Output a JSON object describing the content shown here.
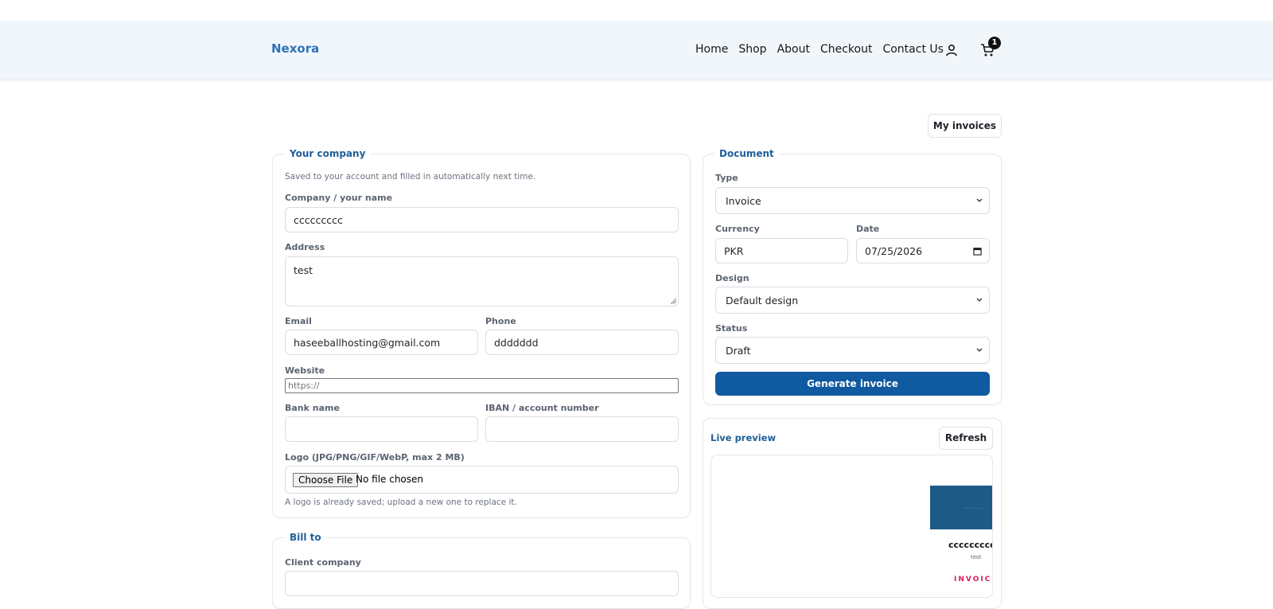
{
  "nav": {
    "brand": "Nexora",
    "links": [
      "Home",
      "Shop",
      "About",
      "Checkout",
      "Contact Us"
    ],
    "cart_count": "1",
    "icons": {
      "account": "user-icon",
      "cart": "cart-icon"
    }
  },
  "toolbar": {
    "my_invoices": "My invoices"
  },
  "company": {
    "legend": "Your company",
    "help": "Saved to your account and filled in automatically next time.",
    "name_label": "Company / your name",
    "name_value": "ccccccccc",
    "address_label": "Address",
    "address_value": "test",
    "email_label": "Email",
    "email_value": "haseeballhosting@gmail.com",
    "phone_label": "Phone",
    "phone_value": "ddddddd",
    "website_label": "Website",
    "website_placeholder": "https://",
    "bank_label": "Bank name",
    "bank_value": "",
    "iban_label": "IBAN / account number",
    "iban_value": "",
    "logo_label": "Logo (JPG/PNG/GIF/WebP, max 2 MB)",
    "file_button": "Choose File",
    "file_status": "No file chosen",
    "logo_help": "A logo is already saved; upload a new one to replace it."
  },
  "bill_to": {
    "legend": "Bill to",
    "client_label": "Client company",
    "client_value": ""
  },
  "document": {
    "legend": "Document",
    "type_label": "Type",
    "type_value": "Invoice",
    "currency_label": "Currency",
    "currency_value": "PKR",
    "date_label": "Date",
    "date_value": "07/25/2026",
    "design_label": "Design",
    "design_value": "Default design",
    "status_label": "Status",
    "status_value": "Draft",
    "generate": "Generate invoice"
  },
  "preview": {
    "title": "Live preview",
    "refresh": "Refresh",
    "company": "ccccccccc",
    "address": "test",
    "doc_title": "INVOICE"
  },
  "colors": {
    "accent": "#1f5f99",
    "brand": "#2f73b5",
    "primary_button": "#0f5aa0",
    "header_bg": "#f1f6fb",
    "preview_header": "#1e5a86",
    "invoice_title": "#d81b60"
  }
}
